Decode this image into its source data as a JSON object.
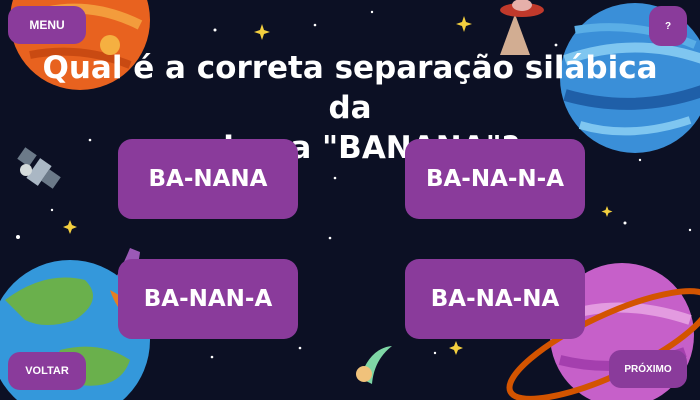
{
  "nav": {
    "menu_label": "MENU",
    "help_label": "?",
    "back_label": "VOLTAR",
    "next_label": "PRÓXIMO"
  },
  "question": {
    "line1": "Qual é a correta separação silábica da",
    "line2": "palavra \"BANANA\"?"
  },
  "answers": [
    "BA-NANA",
    "BA-NA-N-A",
    "BA-NAN-A",
    "BA-NA-NA"
  ],
  "colors": {
    "background": "#0c1024",
    "button": "#8a3b9b",
    "text": "#ffffff"
  }
}
